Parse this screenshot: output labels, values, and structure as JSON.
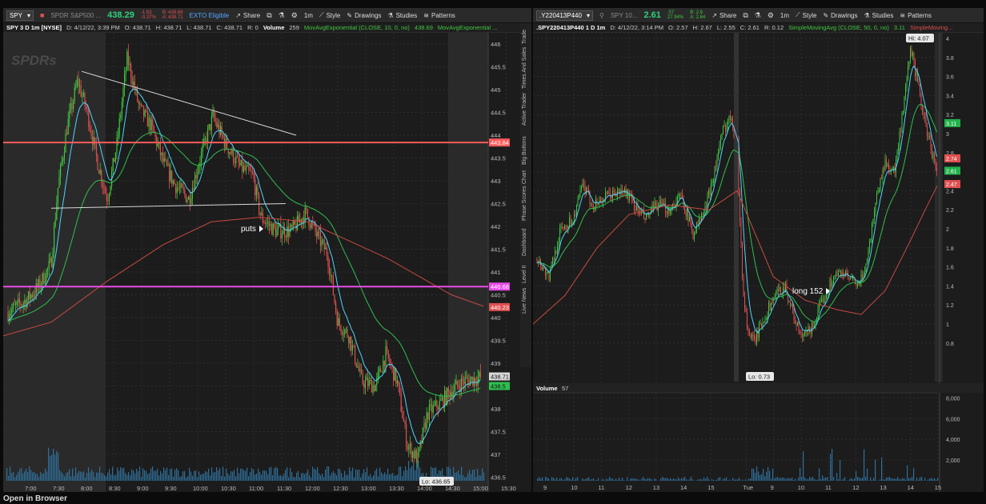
{
  "left": {
    "toolbar": {
      "symbol": "SPY",
      "description": "SPDR S&P500 ...",
      "price": "438.29",
      "change_top": "-1.63",
      "change_bottom": "-0.37%",
      "bid": "B: 438.68",
      "ask": "A: 438.71",
      "eligible": "EXTO Eligible",
      "share": "Share",
      "timeframe": "1m",
      "style": "Style",
      "drawings": "Drawings",
      "studies": "Studies",
      "patterns": "Patterns"
    },
    "info": {
      "title": "SPY 3 D 1m [NYSE]",
      "date": "D: 4/12/22, 3:39 PM",
      "open": "O: 438.71",
      "high": "H: 438.71",
      "low": "L: 438.71",
      "close": "C: 438.71",
      "range": "R: 0",
      "volume_label": "Volume",
      "volume_value": "259",
      "study1": "MovAvgExponential (CLOSE, 10, 0, no)",
      "study1_value": "438.69",
      "study2": "MovAvgExponential ..."
    },
    "watermark": "SPDRs",
    "price_ticks": [
      "446",
      "445.5",
      "445",
      "444.5",
      "444",
      "443.5",
      "443",
      "442.5",
      "442",
      "441.5",
      "441",
      "440.5",
      "440",
      "439.5",
      "439",
      "438.5",
      "438",
      "437.5",
      "437",
      "436.5"
    ],
    "time_ticks": [
      "7:00",
      "7:30",
      "8:00",
      "8:30",
      "9:00",
      "9:30",
      "10:00",
      "10:30",
      "11:00",
      "11:30",
      "12:00",
      "12:30",
      "13:00",
      "13:30",
      "14:00",
      "14:30",
      "15:00",
      "15:30"
    ],
    "badges": {
      "red_line": "443.84",
      "magenta_line": "440.68",
      "ma_red": "440.23",
      "last": "438.71",
      "ema": "438.5"
    },
    "annotation_puts": "puts",
    "low_label": "Lo: 436.65",
    "side_tabs": [
      "Trade",
      "Times And Sales",
      "Active Trader",
      "Big Buttons",
      "Chart",
      "Phase Scores",
      "Dashboard",
      "Level II",
      "Live News"
    ]
  },
  "right": {
    "toolbar": {
      "symbol": ".Y220413P440",
      "description": "SPY 10...",
      "price": "2.61",
      "change_top": ".57",
      "change_bottom": "27.94%",
      "bid": "B: 2.6",
      "ask": "A: 2.64",
      "share": "Share",
      "timeframe": "1m",
      "style": "Style",
      "drawings": "Drawings",
      "studies": "Studies",
      "patterns": "Patterns"
    },
    "info": {
      "title": ".SPY220413P440 1 D 1m",
      "date": "D: 4/12/22, 3:14 PM",
      "open": "O: 2.57",
      "high": "H: 2.67",
      "low": "L: 2.55",
      "close": "C: 2.61",
      "range": "R: 0.12",
      "study1": "SimpleMovingAvg (CLOSE, 50, 0, no)",
      "study1_value": "3.11",
      "study2": "SimpleMoving..."
    },
    "price_ticks": [
      "4",
      "3.8",
      "3.6",
      "3.4",
      "3.2",
      "3",
      "2.8",
      "2.6",
      "2.4",
      "2.2",
      "2",
      "1.8",
      "1.6",
      "1.4",
      "1.2",
      "1",
      "0.8"
    ],
    "time_ticks": [
      "9",
      "10",
      "11",
      "12",
      "13",
      "14",
      "15",
      "Tue",
      "9",
      "10",
      "11",
      "12",
      "13",
      "14",
      "15"
    ],
    "badges": {
      "ma_green": "3.11",
      "red_top": "2.74",
      "last": "2.61",
      "red_bottom": "2.47"
    },
    "hi_label": "Hi: 4.07",
    "low_label": "Lo: 0.73",
    "annotation_long": "long 152",
    "volume": {
      "label": "Volume",
      "value": "57",
      "ticks": [
        "8,000",
        "6,000",
        "4,000",
        "2,000"
      ]
    }
  },
  "footer": "Open in Browser",
  "colors": {
    "red_line": "#ff5a5a",
    "magenta_line": "#e84ce8",
    "ema_fast": "#4fd4ff",
    "ema_slow": "#2fbf4f",
    "ma_long": "#c84a40",
    "up": "#3ec83e",
    "down": "#e05050"
  }
}
